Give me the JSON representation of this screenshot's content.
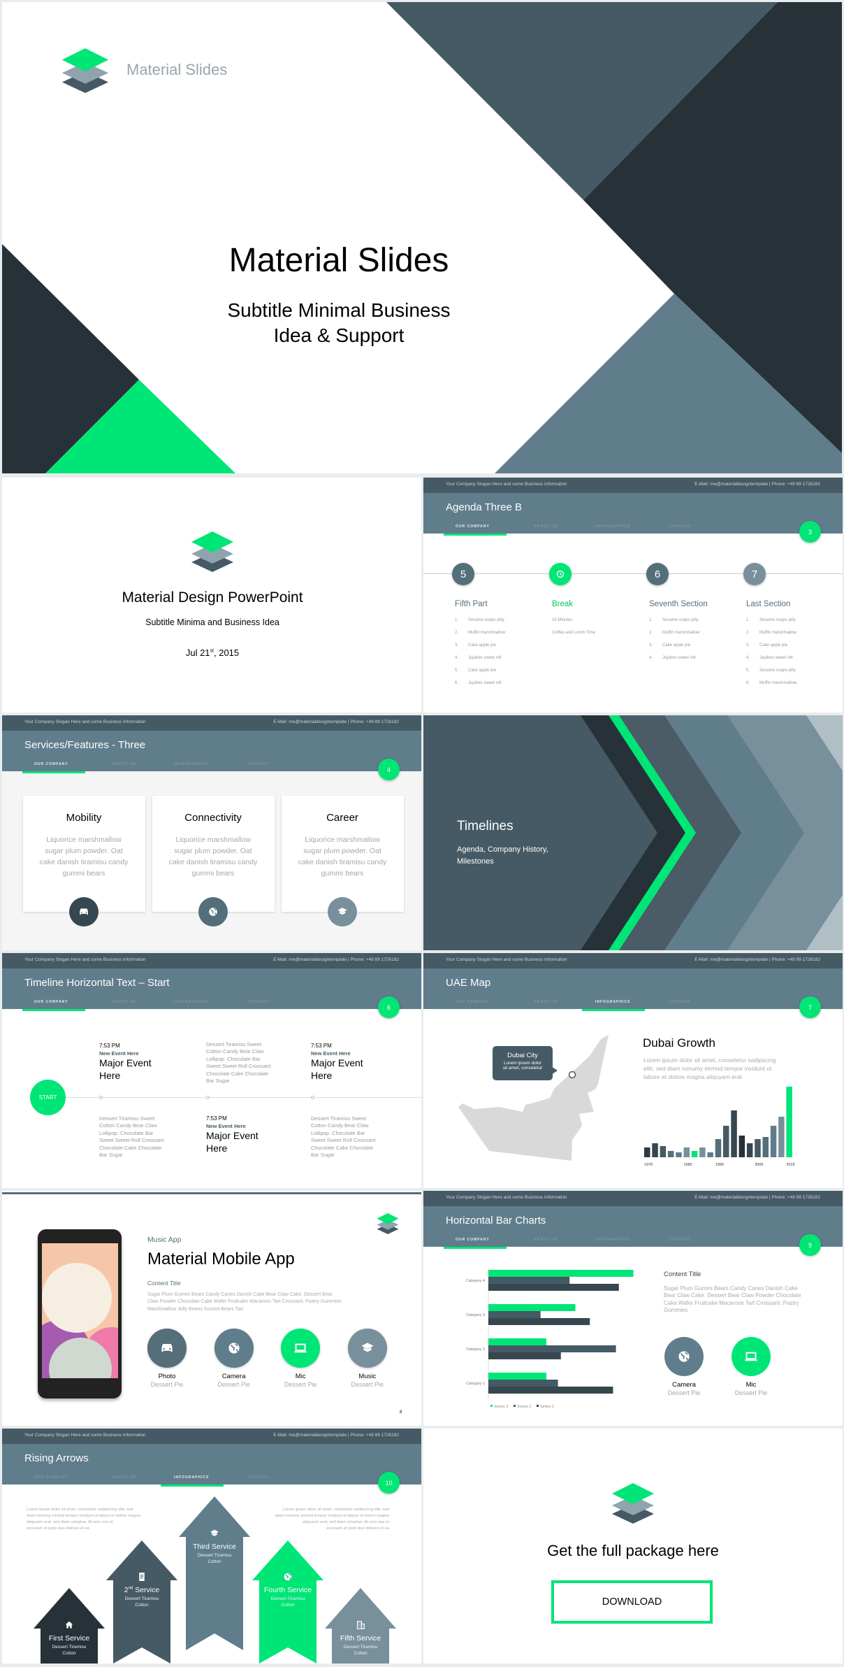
{
  "colors": {
    "green": "#00e676",
    "slate": "#455a64",
    "dark": "#263238",
    "bluegrey": "#607d8b",
    "lightgrey": "#78909c"
  },
  "common": {
    "slogan": "Your Company Slogan Here and some Business Information",
    "contact": "E-Mail: me@materialdesigntemplate | Phone: +49 89 1726182",
    "tabs": [
      "OUR COMPANY",
      "ABOUT US",
      "INFOGRAPHICS",
      "CONTACT"
    ]
  },
  "cover": {
    "logo_text": "Material Slides",
    "title": "Material Slides",
    "subtitle_line1": "Subtitle Minimal Business",
    "subtitle_line2": "Idea & Support"
  },
  "intro": {
    "title": "Material Design PowerPoint",
    "subtitle": "Subtitle Minima and Business  Idea",
    "date_day": "Jul 21",
    "date_sup": "st",
    "date_year": ", 2015"
  },
  "agenda": {
    "title": "Agenda Three B",
    "active_tab": 0,
    "page": "3",
    "columns": [
      {
        "marker": "5",
        "heading": "Fifth Part",
        "numbered": true,
        "items": [
          "Sesame snaps jelly",
          "Muffin marshmallow",
          "Cake apple pie",
          "Jujubes sweet roll",
          "Cake apple pie",
          "Jujubes sweet roll"
        ]
      },
      {
        "marker_icon": "history-icon",
        "heading": "Break",
        "numbered": false,
        "items": [
          "15 Minutes",
          "Coffee and Lunch Time"
        ]
      },
      {
        "marker": "6",
        "heading": "Seventh Section",
        "numbered": true,
        "items": [
          "Sesame snaps jelly",
          "Muffin marshmallow",
          "Cake apple pie",
          "Jujubes sweet roll"
        ]
      },
      {
        "marker": "7",
        "heading": "Last Section",
        "numbered": true,
        "items": [
          "Sesame snaps jelly",
          "Muffin marshmallow",
          "Cake apple pie",
          "Jujubes sweet roll",
          "Sesame snaps jelly",
          "Muffin marshmallow"
        ]
      }
    ]
  },
  "services": {
    "title": "Services/Features  - Three",
    "active_tab": 0,
    "page": "4",
    "cards": [
      {
        "title": "Mobility",
        "body": [
          "Liquorice marshmallow",
          "sugar plum  powder.  Oat",
          "cake danish tiramisu candy",
          "gummi  bears"
        ],
        "icon": "car"
      },
      {
        "title": "Connectivity",
        "body": [
          "Liquorice marshmallow",
          "sugar plum  powder.  Oat",
          "cake danish tiramisu candy",
          "gummi  bears"
        ],
        "icon": "globe"
      },
      {
        "title": "Career",
        "body": [
          "Liquorice marshmallow",
          "sugar plum  powder.  Oat",
          "cake danish tiramisu candy",
          "gummi  bears"
        ],
        "icon": "school"
      }
    ]
  },
  "timelines": {
    "title": "Timelines",
    "subtitle_line1": "Agenda, Company History,",
    "subtitle_line2": "Milestones"
  },
  "timeline_h": {
    "title": "Timeline Horizontal Text – Start",
    "active_tab": 0,
    "page": "6",
    "start": "START",
    "events": [
      {
        "time": "7:53 PM",
        "label": "New Event Here",
        "title_line1": "Major Event",
        "title_line2": "Here"
      },
      {
        "time": "7:53 PM",
        "label": "New Event Here",
        "title_line1": "Major Event",
        "title_line2": "Here"
      },
      {
        "time": "7:53 PM",
        "label": "New Event Here",
        "title_line1": "Major Event",
        "title_line2": "Here"
      }
    ],
    "desc": [
      "Dessert Tiramisu Sweet",
      "Cotton Candy Bear Claw",
      "Lollipop. Chocolate Bar",
      "Sweet Sweet Roll Croissant",
      "Chocolate Cake Chocolate",
      "Bar Sugar"
    ]
  },
  "uae": {
    "title": "UAE Map",
    "active_tab": 2,
    "page": "7",
    "callout_title": "Dubai City",
    "callout_line1": "Lorem ipsum dolor",
    "callout_line2": "sit amet, consetetur",
    "heading": "Dubai Growth",
    "body": [
      "Lorem ipsum dolor sit amet, consetetur sadipscing",
      "elitr, sed diam nonumy  eirmod tempor invidunt  ut",
      "labore et dolore magna aliquyam  erat"
    ]
  },
  "chart_data": [
    {
      "type": "bar",
      "title": "",
      "tick_labels": [
        "1970",
        "1982",
        "1996",
        "2006",
        "2015"
      ],
      "tick_index": [
        0,
        5,
        9,
        14,
        18
      ],
      "values": [
        14,
        20,
        16,
        9,
        7,
        14,
        9,
        14,
        7,
        26,
        45,
        67,
        31,
        20,
        26,
        29,
        45,
        58,
        101
      ],
      "bar_colors": [
        "#2c3a41",
        "#37474f",
        "#455a64",
        "#546e7a",
        "#607d8b",
        "#78909c",
        "#00e676",
        "#78909c",
        "#607d8b",
        "#546e7a",
        "#455a64",
        "#37474f",
        "#263238",
        "#37474f",
        "#455a64",
        "#546e7a",
        "#607d8b",
        "#78909c",
        "#00e676"
      ]
    },
    {
      "type": "bar",
      "orientation": "horizontal",
      "categories": [
        "Category 1",
        "Category 2",
        "Category 3",
        "Category 4"
      ],
      "series": [
        {
          "name": "Series 1",
          "color": "#37474f",
          "values": [
            4.3,
            2.5,
            3.5,
            4.5
          ]
        },
        {
          "name": "Series 2",
          "color": "#455a64",
          "values": [
            2.4,
            4.4,
            1.8,
            2.8
          ]
        },
        {
          "name": "Series 3",
          "color": "#00e676",
          "values": [
            2,
            2,
            3,
            5
          ]
        }
      ],
      "xlim": [
        0,
        5.5
      ],
      "legend": "bottom",
      "grid": false
    }
  ],
  "mobile": {
    "kicker": "Music App",
    "title": "Material Mobile App",
    "content_title": "Content Title",
    "body": [
      "Sugar Plum Gummi Bears Candy Canes Danish Cake Bear Claw Cake. Dessert Bear",
      "Claw Powder Chocolate Cake Wafer Fruitcake Macaroon Tart Croissant. Pastry Gummies",
      "Marshmallow Jelly Beans Gummi Bears Tart"
    ],
    "page": "8",
    "features": [
      {
        "label": "Photo",
        "sub": "Dessert Pie",
        "icon": "car",
        "color": "#546e7a"
      },
      {
        "label": "Camera",
        "sub": "Dessert Pie",
        "icon": "globe",
        "color": "#607d8b"
      },
      {
        "label": "Mic",
        "sub": "Dessert Pie",
        "icon": "laptop",
        "color": "#00e676"
      },
      {
        "label": "Music",
        "sub": "Dessert Pie",
        "icon": "school",
        "color": "#78909c"
      }
    ]
  },
  "hbar": {
    "title": "Horizontal Bar Charts",
    "active_tab": 0,
    "page": "9",
    "content_title": "Content Title",
    "body": [
      "Sugar Plum Gummi Bears Candy Canes Danish Cake",
      "Bear Claw Cake. Dessert Bear Claw Powder Chocolate",
      "Cake Wafer Fruitcake Macaroon Tart Croissant. Pastry",
      "Gummies"
    ],
    "features": [
      {
        "label": "Camera",
        "sub": "Dessert Pie",
        "icon": "globe",
        "color": "#607d8b"
      },
      {
        "label": "Mic",
        "sub": "Dessert Pie",
        "icon": "laptop",
        "color": "#00e676"
      }
    ]
  },
  "arrows": {
    "title": "Rising Arrows",
    "active_tab": 2,
    "page": "10",
    "left_text": [
      "Lorem ipsum dolor sit amet, consetetur sadipscing elitr, sed",
      "diam nonumy eirmod tempor invidunt ut labore et dolore magna",
      "aliquyam erat, sed diam voluptua. At vero eos et",
      "accusam et justo duo dolores et ea"
    ],
    "right_text": [
      "Lorem ipsum dolor sit amet, consetetur sadipscing elitr, sed",
      "diam nonumy eirmod tempor invidunt ut labore et dolore magna",
      "aliquyam erat, sed diam voluptua. At vero eos et",
      "accusam et justo duo dolores et ea"
    ],
    "items": [
      {
        "title": "First Service",
        "sub1": "Dessert Tiramisu",
        "sub2": "Cotton",
        "icon": "home",
        "color": "#263238"
      },
      {
        "title": "2nd Service",
        "sup": "nd",
        "sub1": "Dessert Tiramisu",
        "sub2": "Cotton",
        "icon": "doc",
        "color": "#455a64"
      },
      {
        "title": "Third Service",
        "sub1": "Dessert Tiramisu",
        "sub2": "Cotton",
        "icon": "school",
        "color": "#607d8b"
      },
      {
        "title": "Fourth Service",
        "sub1": "Dessert Tiramisu",
        "sub2": "Cotton",
        "icon": "globe",
        "color": "#00e676"
      },
      {
        "title": "Fifth Service",
        "sub1": "Dessert Tiramisu",
        "sub2": "Cotton",
        "icon": "building",
        "color": "#78909c"
      }
    ]
  },
  "download": {
    "heading": "Get the full package here",
    "button": "DOWNLOAD"
  }
}
